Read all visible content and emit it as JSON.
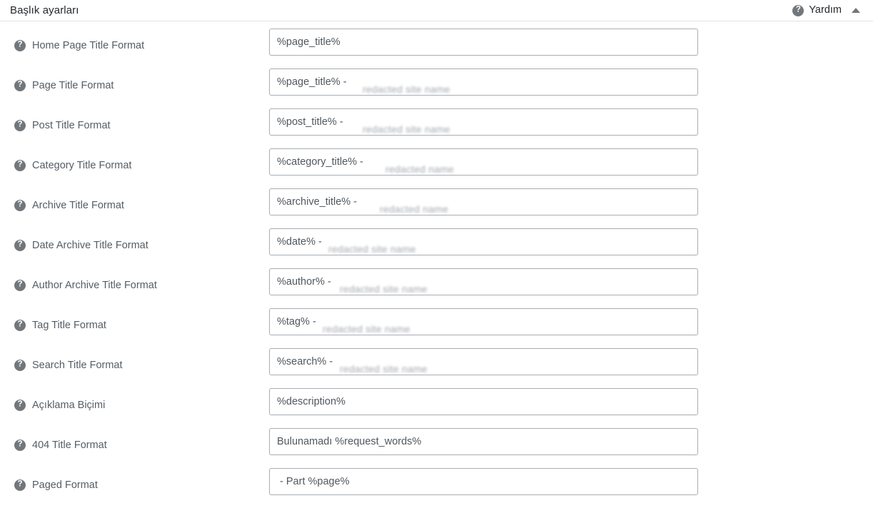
{
  "header": {
    "title": "Başlık ayarları",
    "help_label": "Yardım",
    "help_icon": "question-circle-icon",
    "toggle_icon": "caret-up-icon"
  },
  "form": {
    "icon": "question-circle-icon",
    "rows": [
      {
        "label": "Home Page Title Format",
        "value": "%page_title%",
        "redacted": ""
      },
      {
        "label": "Page Title Format",
        "value": "%page_title% - ",
        "redacted": "redacted site name"
      },
      {
        "label": "Post Title Format",
        "value": "%post_title% - ",
        "redacted": "redacted site name"
      },
      {
        "label": "Category Title Format",
        "value": "%category_title% - ",
        "redacted": "redacted name"
      },
      {
        "label": "Archive Title Format",
        "value": "%archive_title% - ",
        "redacted": "redacted name"
      },
      {
        "label": "Date Archive Title Format",
        "value": "%date% - ",
        "redacted": "redacted site name"
      },
      {
        "label": "Author Archive Title Format",
        "value": "%author% - ",
        "redacted": "redacted site name"
      },
      {
        "label": "Tag Title Format",
        "value": "%tag% - ",
        "redacted": "redacted site name"
      },
      {
        "label": "Search Title Format",
        "value": "%search% - ",
        "redacted": "redacted site name"
      },
      {
        "label": "Açıklama Biçimi",
        "value": "%description%",
        "redacted": ""
      },
      {
        "label": "404 Title Format",
        "value": "Bulunamadı %request_words%",
        "redacted": ""
      },
      {
        "label": "Paged Format",
        "value": " - Part %page%",
        "redacted": ""
      }
    ]
  },
  "colors": {
    "text": "#555d66",
    "title": "#23282d",
    "icon_bg": "#72777c",
    "input_border": "#a8adb3",
    "divider": "#e2e2e2"
  }
}
